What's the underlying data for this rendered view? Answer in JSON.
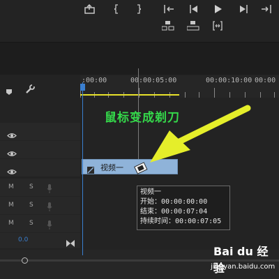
{
  "ruler": {
    "timecodes": [
      ":00:00",
      "00:00:05:00",
      "00:00:10:00",
      "00:00"
    ]
  },
  "annotation": "鼠标变成剃刀",
  "clip": {
    "label": "视频一"
  },
  "tooltip": {
    "name": "视频一",
    "start": "开始：00:00:00:00",
    "end": "结束：00:00:07:04",
    "duration": "持续时间：00:00:07:05"
  },
  "audio_tracks": [
    {
      "m": "M",
      "s": "S"
    },
    {
      "m": "M",
      "s": "S"
    },
    {
      "m": "M",
      "s": "S"
    }
  ],
  "volume_value": "0.0",
  "watermark": {
    "site": "Bai du 经验",
    "url": "jingyan.baidu.com"
  },
  "colors": {
    "accent_blue": "#3a7fd0",
    "clip": "#8fb3d9",
    "annotation": "#34d84a",
    "arrow": "#e5ee2a"
  }
}
